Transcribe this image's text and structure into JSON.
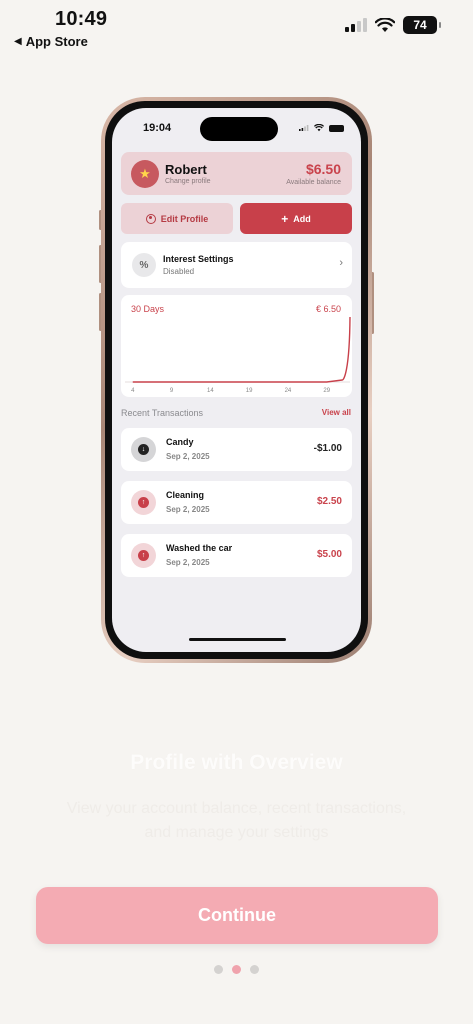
{
  "status_bar": {
    "time": "10:49",
    "back_label": "App Store",
    "battery": "74",
    "signal_bars_on": 2,
    "signal_bars_total": 4
  },
  "phone": {
    "status_time": "19:04",
    "profile": {
      "name": "Robert",
      "subtitle": "Change profile",
      "balance": "$6.50",
      "balance_label": "Available balance",
      "avatar_icon": "star-icon"
    },
    "actions": {
      "edit_label": "Edit Profile",
      "add_label": "Add"
    },
    "interest": {
      "icon_text": "%",
      "title": "Interest Settings",
      "status": "Disabled"
    },
    "chart": {
      "period_label": "30 Days",
      "value_label": "€ 6.50"
    },
    "recent": {
      "heading": "Recent Transactions",
      "view_all": "View all",
      "items": [
        {
          "name": "Candy",
          "date": "Sep 2, 2025",
          "amount": "-$1.00",
          "direction": "out"
        },
        {
          "name": "Cleaning",
          "date": "Sep 2, 2025",
          "amount": "$2.50",
          "direction": "in"
        },
        {
          "name": "Washed the car",
          "date": "Sep 2, 2025",
          "amount": "$5.00",
          "direction": "in"
        }
      ]
    }
  },
  "onboarding": {
    "title": "Profile with Overview",
    "description": "View your account balance, recent transactions, and manage your settings",
    "continue_label": "Continue",
    "page_count": 3,
    "active_page": 1
  },
  "colors": {
    "accent": "#c8404a",
    "continue_bg": "#f4abb3",
    "page_bg": "#f6f4f1"
  },
  "chart_data": {
    "type": "line",
    "title": "",
    "x_ticks": [
      "4",
      "9",
      "14",
      "19",
      "24",
      "29"
    ],
    "x": [
      4,
      9,
      14,
      19,
      24,
      29,
      31,
      32
    ],
    "y": [
      0,
      0,
      0,
      0,
      0,
      0,
      0.2,
      6.5
    ],
    "ylim": [
      0,
      6.5
    ],
    "grid": false,
    "series": [
      {
        "values": [
          0,
          0,
          0,
          0,
          0,
          0,
          0.2,
          6.5
        ]
      }
    ]
  }
}
